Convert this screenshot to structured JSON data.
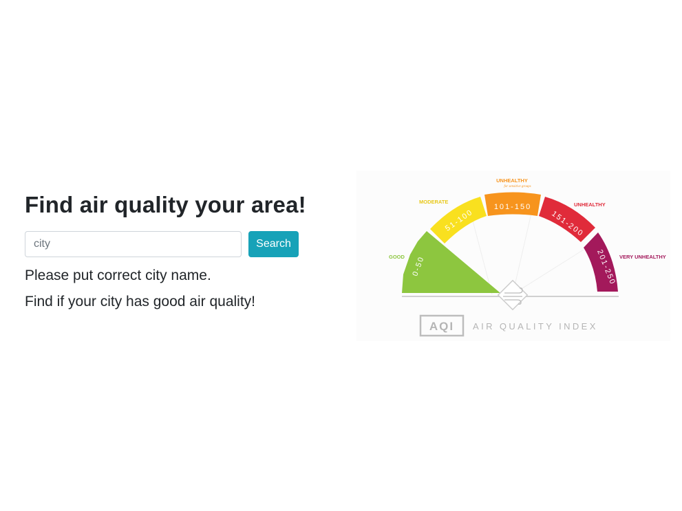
{
  "header": {
    "title": "Find air quality your area!"
  },
  "search": {
    "placeholder": "city",
    "value": "",
    "button_label": "Search"
  },
  "messages": {
    "error": "Please put correct city name.",
    "hint": "Find if your city has good air quality!"
  },
  "aqi_image": {
    "badge": "AQI",
    "caption": "AIR QUALITY INDEX",
    "categories": [
      {
        "label": "GOOD",
        "range": "0-50",
        "color": "#8dc63f"
      },
      {
        "label": "MODERATE",
        "range": "51-100",
        "color": "#f9e01f"
      },
      {
        "label": "UNHEALTHY",
        "sublabel": "for sensitive groups",
        "range": "101-150",
        "color": "#f7941d"
      },
      {
        "label": "UNHEALTHY",
        "range": "151-200",
        "color": "#e02b3a"
      },
      {
        "label": "VERY UNHEALTHY",
        "range": "201-250",
        "color": "#a3195b"
      }
    ]
  }
}
